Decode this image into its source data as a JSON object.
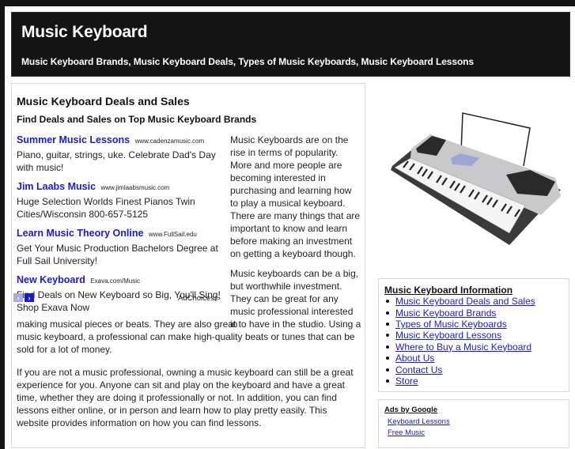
{
  "header": {
    "title": "Music Keyboard",
    "tagline": "Music Keyboard Brands, Music Keyboard Deals, Types of Music Keyboards, Music Keyboard Lessons"
  },
  "main": {
    "heading": "Music Keyboard Deals and Sales",
    "subheading": "Find Deals and Sales on Top Music Keyboard Brands",
    "ads": [
      {
        "title": "Summer Music Lessons",
        "url": "www.cadenzamusic.com",
        "desc": "Piano, guitar, strings, uke. Celebrate Dad's Day with music!"
      },
      {
        "title": "Jim Laabs Music",
        "url": "www.jimlaabsmusic.com",
        "desc": "Huge Selection Worlds Finest Pianos Twin Cities/Wisconsin 800-657-5125"
      },
      {
        "title": "Learn Music Theory Online",
        "url": "www.FullSail.edu",
        "desc": "Get Your Music Production Bachelors Degree at Full Sail University!"
      },
      {
        "title": "New Keyboard",
        "url": "Exava.com/Music",
        "desc": "Find Deals on New Keyboard so Big, You'll Sing! Shop Exava Now"
      }
    ],
    "ad_nav": {
      "prev": "‹",
      "next": "›"
    },
    "adchoices_label": "AdChoices",
    "paragraph1": "Music Keyboards are on the rise in terms of popularity. More and more people are becoming interested in purchasing and learning how to play a musical keyboard. There are many things that are important to know and learn before making an investment on getting a keyboard though.",
    "paragraph2_start": "Music keyboards can be a big, but worthwhile investment. They can be great for any music professional interested in",
    "paragraph2_end": "making musical pieces or beats. They are also great to have in the studio. Using a music keyboard, a professional can make high-quality beats or tunes that can be sold for a lot of money.",
    "paragraph3": "If you are not a music professional, owning a music keyboard can still be a great experience for you. Anyone can sit and play on the keyboard and have a great time, whether they are doing it professionally or not. In addition, you can find lessons either online, or in person and learn how to play pretty easily. This website provides information on how you can find lessons."
  },
  "sidebar": {
    "image_alt": "Music keyboard product photo",
    "info_title": "Music Keyboard Information",
    "info_links": [
      "Music Keyboard Deals and Sales",
      "Music Keyboard Brands",
      "Types of Music Keyboards",
      "Music Keyboard Lessons",
      "Where to Buy a Music Keyboard",
      "About Us",
      "Contact Us",
      "Store"
    ],
    "ads_title": "Ads by Google",
    "ads_links": [
      "Keyboard Lessons",
      "Free Music"
    ]
  }
}
